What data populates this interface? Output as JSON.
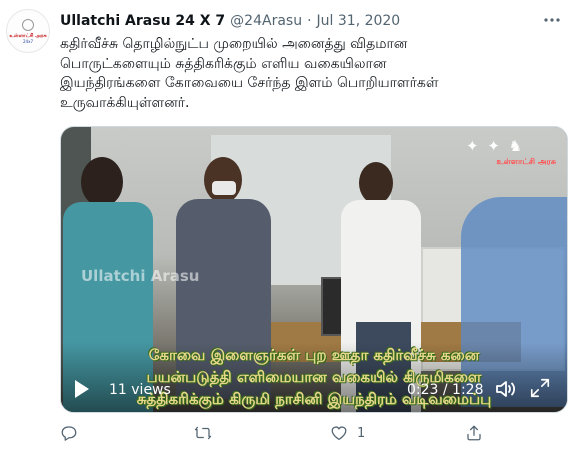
{
  "tweet": {
    "author_name": "Ullatchi Arasu 24 X 7",
    "handle": "@24Arasu",
    "separator": "·",
    "date": "Jul 31, 2020",
    "more_icon": "more-dots-icon",
    "text_lines": [
      "கதிர்வீச்சு தொழில்நுட்ப முறையில் அனைத்து விதமான",
      "பொருட்களையும் சுத்திகரிக்கும் எளிய வகையிலான",
      "இயந்திரங்களை கோவையை சேர்ந்த இளம் பொறியாளர்கள்",
      "உருவாக்கியுள்ளனர்."
    ]
  },
  "avatar": {
    "logo_text": "உள்ளாட்சி அரசு",
    "logo_subtext": "24x7"
  },
  "video": {
    "views": "11 views",
    "time": "0:23 / 1:28",
    "watermark": "Ullatchi Arasu",
    "overlay_brand": "உள்ளாட்சி அரசு",
    "subtitle_lines": [
      "கோவை இளைஞர்கள் புற ஊதா கதிர்வீச்சு கனை",
      "பயன்படுத்தி எளிமையான வகையில் கிருமிகளை",
      "சுத்திகரிக்கும் கிருமி நாசினி இயந்திரம் வடிவமைப்பு"
    ],
    "icons": [
      "play-icon",
      "volume-icon",
      "expand-icon"
    ]
  },
  "actions": {
    "reply_icon": "reply-icon",
    "retweet_icon": "retweet-icon",
    "like_icon": "like-icon",
    "like_count": "1",
    "share_icon": "share-icon"
  },
  "colors": {
    "text_primary": "#0f1419",
    "text_secondary": "#536471",
    "border": "#cfd9de",
    "subtitle": "#e6d88a"
  }
}
